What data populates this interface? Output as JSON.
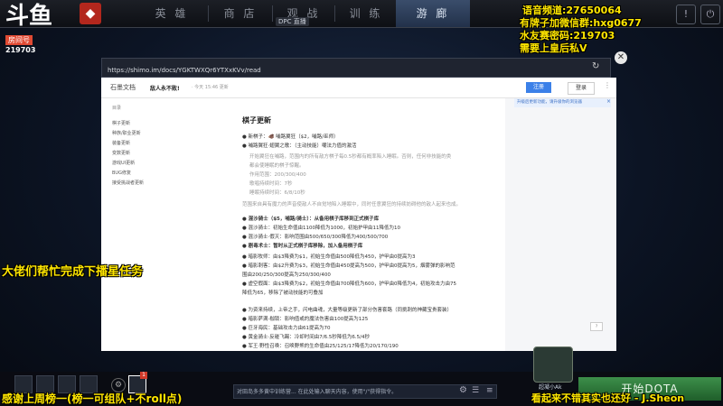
{
  "nav": {
    "tabs": [
      "英 雄",
      "商 店",
      "观 战",
      "训 练",
      "游 廊"
    ],
    "active_tab": "游 廊",
    "dpc_badge": "DPC 直播"
  },
  "douyu": {
    "logo": "斗鱼",
    "room_label": "房间号",
    "room_number": "219703"
  },
  "overlay": {
    "top_right": [
      "语音频道:27650064",
      "有牌子加微信群:hxg0677",
      "水友赛密码:219703",
      "需要上皇后私V"
    ],
    "left_banner": "大佬们帮忙完成下播星任务",
    "bottom_left": "感谢上周榜一(榜一可组队+不roll点)",
    "bottom_right": "看起来不错其实也还好 - J.Sheon"
  },
  "browser": {
    "url": "https://shimo.im/docs/YGKTWXQr6YTXxKVv/read"
  },
  "doc": {
    "brand": "石墨文档",
    "title": "敌人永不败!",
    "meta": "· 今天 15:46 更新",
    "register": "注册",
    "login": "登录",
    "banner": "升级后更新功能，请升级你的浏览器",
    "sidebar_title": "目录",
    "toc": [
      "棋子更新",
      "种族/职业更新",
      "装备更新",
      "变数更新",
      "游戏UI更新",
      "BUG修复",
      "接受挑战者更新"
    ],
    "heading": "棋子更新",
    "lines": [
      {
        "t": "● 新棋子：🐗 哺路翼狂（$2，哺路/巫师）",
        "s": "b"
      },
      {
        "t": "● 哺路翼狂·翅翼之歌：（主动技能）嘲法力值的激活",
        "s": ""
      },
      {
        "t": "开始翼狂在哺路，范围内的所有敌方棋子每0.5秒都有概率陷入睡眠。否则，任何非技能的类",
        "s": "gray"
      },
      {
        "t": "都会使睡眠的棋子惊醒。",
        "s": "gray"
      },
      {
        "t": "作用范围：200/300/400",
        "s": "gray"
      },
      {
        "t": "歌唱持续时间：7秒",
        "s": "gray"
      },
      {
        "t": "睡眠持续时间：6/8/10秒",
        "s": "gray"
      },
      {
        "t": "范围来自具有魔力的声音使敌人不自觉地陷入睡眠中，同时任意翼狂的持续妨碍他的敌人起来也成。",
        "s": "gray"
      },
      {
        "t": "● 混沙骑士（$5，哺路/骑士）：从备用棋子库移到正式棋子库",
        "s": "b"
      },
      {
        "t": "● 混沙骑士：初始生命值由1100降低为1000，初始护甲由11降低为10",
        "s": ""
      },
      {
        "t": "● 混沙骑士·假灭：影响范围由500/650/300降低为400/500/700",
        "s": ""
      },
      {
        "t": "● 剧毒术士：暂时从正式棋子库移除，加入备用棋子库",
        "s": "b"
      },
      {
        "t": "● 暗影牧师：由$3降费为$1，初始生命值由500降低为450，护甲由0提高为3",
        "s": ""
      },
      {
        "t": "● 暗影刺客：由$2升费为$3，初始生命值由450提高为500，护甲由0提高为5，烟雾弹的影响范",
        "s": ""
      },
      {
        "t": "围由200/250/300提高为250/300/400",
        "s": ""
      },
      {
        "t": "● 虚空假面：由$3降费为$2，初始生命值由700降低为600，护甲由0降低为4，初始攻击力由75",
        "s": ""
      },
      {
        "t": "降低为65，移除了被动技能的可叠加",
        "s": ""
      },
      {
        "t": "● 为资来持续，上帝之手，闪电曲魂，大量等级更新了部分伤害套路（同挑刺的神藏宝贵套装）",
        "s": ""
      },
      {
        "t": "● 暗影萨满·枷锁：影响值或的魔法伤害由100提高为125",
        "s": ""
      },
      {
        "t": "● 巨牙海民：基础攻击力由61提高为70",
        "s": ""
      },
      {
        "t": "● 黄金骑士·反碰飞踢：冷却时间由7/6.5秒降低为6.5/4秒",
        "s": ""
      },
      {
        "t": "● 军王·野性召唤：召唤野熊的生命值由25/125/17降低为20/170/190",
        "s": ""
      }
    ]
  },
  "bottom": {
    "chat_placeholder": "对田岛多多黄中训练营... 在此处输入聊天内容，使用\"/\"获得指令。",
    "friend_label": "超凝小Ak",
    "start_button": "开始DOTA"
  },
  "colors": {
    "overlay_yellow": "#ffe600",
    "active_tab": "#3a4d6b",
    "start_green": "#2f7a3a"
  }
}
